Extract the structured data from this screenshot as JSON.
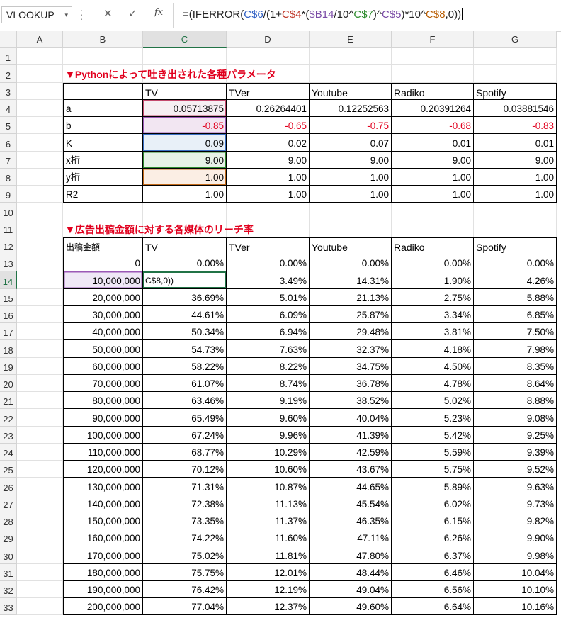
{
  "formula_bar": {
    "name_box": "VLOOKUP",
    "name_box_dropdown": "▾",
    "cancel_icon": "✕",
    "enter_icon": "✓",
    "fx_label": "fx",
    "formula_parts": [
      {
        "t": "=(IFERROR(",
        "c": ""
      },
      {
        "t": "C$6",
        "c": "r1"
      },
      {
        "t": "/(1+",
        "c": ""
      },
      {
        "t": "C$4",
        "c": "r2"
      },
      {
        "t": "*(",
        "c": ""
      },
      {
        "t": "$B14",
        "c": "r3"
      },
      {
        "t": "/10^",
        "c": ""
      },
      {
        "t": "C$7",
        "c": "r4"
      },
      {
        "t": ")^",
        "c": ""
      },
      {
        "t": "C$5",
        "c": "r3"
      },
      {
        "t": ")*10^",
        "c": ""
      },
      {
        "t": "C$8",
        "c": "r5"
      },
      {
        "t": ",0))",
        "c": ""
      }
    ]
  },
  "columns": [
    "A",
    "B",
    "C",
    "D",
    "E",
    "F",
    "G"
  ],
  "selected_column": "C",
  "selected_row": "14",
  "rows": [
    "1",
    "2",
    "3",
    "4",
    "5",
    "6",
    "7",
    "8",
    "9",
    "10",
    "11",
    "12",
    "13",
    "14",
    "15",
    "16",
    "17",
    "18",
    "19",
    "20",
    "21",
    "22",
    "23",
    "24",
    "25",
    "26",
    "27",
    "28",
    "29",
    "30",
    "31",
    "32",
    "33"
  ],
  "section1": {
    "title": "▼Pythonによって吐き出された各種パラメータ",
    "headers": [
      "",
      "TV",
      "TVer",
      "Youtube",
      "Radiko",
      "Spotify"
    ],
    "rows": [
      {
        "label": "a",
        "values": [
          "0.05713875",
          "0.26264401",
          "0.12252563",
          "0.20391264",
          "0.03881546"
        ]
      },
      {
        "label": "b",
        "values": [
          "-0.85",
          "-0.65",
          "-0.75",
          "-0.68",
          "-0.83"
        ]
      },
      {
        "label": "K",
        "values": [
          "0.09",
          "0.02",
          "0.07",
          "0.01",
          "0.01"
        ]
      },
      {
        "label": "x桁",
        "values": [
          "9.00",
          "9.00",
          "9.00",
          "9.00",
          "9.00"
        ]
      },
      {
        "label": "y桁",
        "values": [
          "1.00",
          "1.00",
          "1.00",
          "1.00",
          "1.00"
        ]
      },
      {
        "label": "R2",
        "values": [
          "1.00",
          "1.00",
          "1.00",
          "1.00",
          "1.00"
        ]
      }
    ]
  },
  "section2": {
    "title": "▼広告出稿金額に対する各媒体のリーチ率",
    "headers": [
      "出稿金額",
      "TV",
      "TVer",
      "Youtube",
      "Radiko",
      "Spotify"
    ],
    "editing_text": "C$8,0))",
    "rows": [
      {
        "amount": "0",
        "values": [
          "0.00%",
          "0.00%",
          "0.00%",
          "0.00%",
          "0.00%"
        ]
      },
      {
        "amount": "10,000,000",
        "values": [
          "",
          "3.49%",
          "14.31%",
          "1.90%",
          "4.26%"
        ]
      },
      {
        "amount": "20,000,000",
        "values": [
          "36.69%",
          "5.01%",
          "21.13%",
          "2.75%",
          "5.88%"
        ]
      },
      {
        "amount": "30,000,000",
        "values": [
          "44.61%",
          "6.09%",
          "25.87%",
          "3.34%",
          "6.85%"
        ]
      },
      {
        "amount": "40,000,000",
        "values": [
          "50.34%",
          "6.94%",
          "29.48%",
          "3.81%",
          "7.50%"
        ]
      },
      {
        "amount": "50,000,000",
        "values": [
          "54.73%",
          "7.63%",
          "32.37%",
          "4.18%",
          "7.98%"
        ]
      },
      {
        "amount": "60,000,000",
        "values": [
          "58.22%",
          "8.22%",
          "34.75%",
          "4.50%",
          "8.35%"
        ]
      },
      {
        "amount": "70,000,000",
        "values": [
          "61.07%",
          "8.74%",
          "36.78%",
          "4.78%",
          "8.64%"
        ]
      },
      {
        "amount": "80,000,000",
        "values": [
          "63.46%",
          "9.19%",
          "38.52%",
          "5.02%",
          "8.88%"
        ]
      },
      {
        "amount": "90,000,000",
        "values": [
          "65.49%",
          "9.60%",
          "40.04%",
          "5.23%",
          "9.08%"
        ]
      },
      {
        "amount": "100,000,000",
        "values": [
          "67.24%",
          "9.96%",
          "41.39%",
          "5.42%",
          "9.25%"
        ]
      },
      {
        "amount": "110,000,000",
        "values": [
          "68.77%",
          "10.29%",
          "42.59%",
          "5.59%",
          "9.39%"
        ]
      },
      {
        "amount": "120,000,000",
        "values": [
          "70.12%",
          "10.60%",
          "43.67%",
          "5.75%",
          "9.52%"
        ]
      },
      {
        "amount": "130,000,000",
        "values": [
          "71.31%",
          "10.87%",
          "44.65%",
          "5.89%",
          "9.63%"
        ]
      },
      {
        "amount": "140,000,000",
        "values": [
          "72.38%",
          "11.13%",
          "45.54%",
          "6.02%",
          "9.73%"
        ]
      },
      {
        "amount": "150,000,000",
        "values": [
          "73.35%",
          "11.37%",
          "46.35%",
          "6.15%",
          "9.82%"
        ]
      },
      {
        "amount": "160,000,000",
        "values": [
          "74.22%",
          "11.60%",
          "47.11%",
          "6.26%",
          "9.90%"
        ]
      },
      {
        "amount": "170,000,000",
        "values": [
          "75.02%",
          "11.81%",
          "47.80%",
          "6.37%",
          "9.98%"
        ]
      },
      {
        "amount": "180,000,000",
        "values": [
          "75.75%",
          "12.01%",
          "48.44%",
          "6.46%",
          "10.04%"
        ]
      },
      {
        "amount": "190,000,000",
        "values": [
          "76.42%",
          "12.19%",
          "49.04%",
          "6.56%",
          "10.10%"
        ]
      },
      {
        "amount": "200,000,000",
        "values": [
          "77.04%",
          "12.37%",
          "49.60%",
          "6.64%",
          "10.16%"
        ]
      }
    ]
  },
  "colors": {
    "accent": "#217346",
    "title_red": "#e1001e",
    "ref_blue": "#2f5fc4",
    "ref_red": "#c0392b",
    "ref_purple": "#7a4ba6",
    "ref_green": "#2e8b2e",
    "ref_orange": "#b85c00"
  }
}
